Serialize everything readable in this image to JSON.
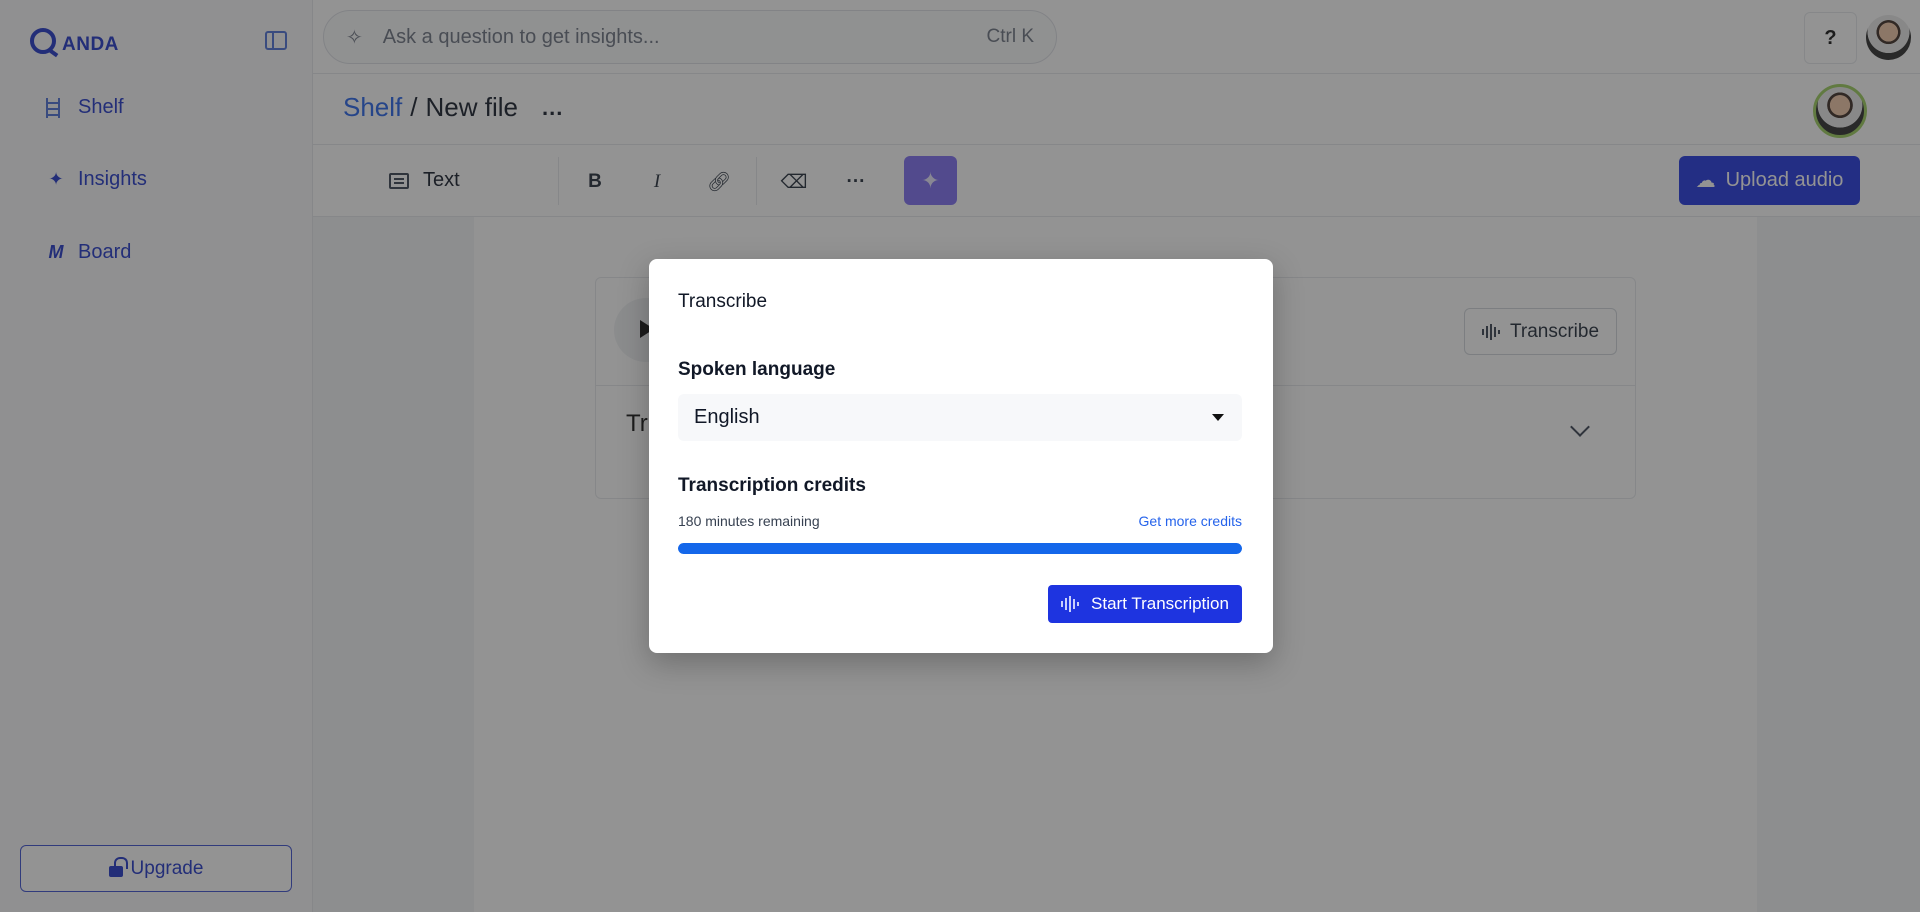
{
  "app": {
    "logo_text": "ANDA"
  },
  "sidebar": {
    "items": [
      {
        "label": "Shelf",
        "icon": "shelf-icon"
      },
      {
        "label": "Insights",
        "icon": "sparkle-icon"
      },
      {
        "label": "Board",
        "icon": "board-icon"
      }
    ],
    "upgrade_label": "Upgrade"
  },
  "topbar": {
    "search_placeholder": "Ask a question to get insights...",
    "search_shortcut": "Ctrl K",
    "help_label": "?"
  },
  "header": {
    "breadcrumb_root": "Shelf",
    "breadcrumb_sep": "/",
    "breadcrumb_current": "New file",
    "more_label": "..."
  },
  "toolbar": {
    "text_style_label": "Text",
    "bold_label": "B",
    "italic_label": "I",
    "more_label": "···",
    "upload_label": "Upload audio"
  },
  "content": {
    "transcribe_chip_label": "Transcribe",
    "section_label": "Tr"
  },
  "modal": {
    "title": "Transcribe",
    "language_label": "Spoken language",
    "language_value": "English",
    "credits_label": "Transcription credits",
    "credits_remaining": "180 minutes remaining",
    "credits_link": "Get more credits",
    "credits_progress_fraction": 1.0,
    "start_label": "Start Transcription"
  },
  "colors": {
    "brand": "#1e34e0",
    "link": "#2563eb",
    "ai_button": "#7c6df2",
    "progress": "#1467ea"
  }
}
